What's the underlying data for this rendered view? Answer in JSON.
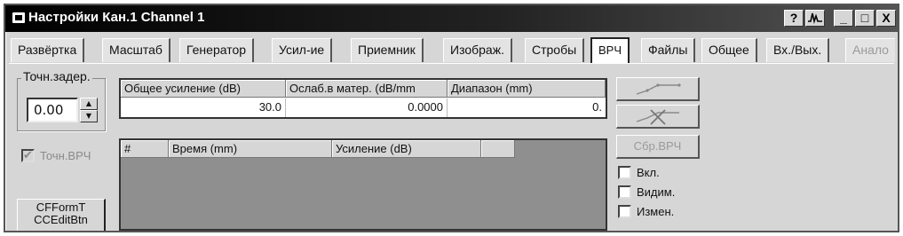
{
  "window": {
    "title": "Настройки Кан.1 Channel 1",
    "controls": [
      "?",
      "",
      "_",
      "□",
      "X"
    ]
  },
  "tabs": [
    {
      "label": "Развёртка"
    },
    {
      "label": "Масштаб"
    },
    {
      "label": "Генератор"
    },
    {
      "label": "Усил-ие"
    },
    {
      "label": "Приемник"
    },
    {
      "label": "Изображ."
    },
    {
      "label": "Стробы"
    },
    {
      "label": "ВРЧ",
      "active": true
    },
    {
      "label": "Файлы"
    },
    {
      "label": "Общее"
    },
    {
      "label": "Вх./Вых."
    },
    {
      "label": "Анало",
      "disabled": true
    }
  ],
  "delay": {
    "group_label": "Точн.задер.",
    "value": "0.00"
  },
  "tvg_checkbox": {
    "label": "Точн.ВРЧ",
    "checked": true,
    "disabled": true
  },
  "cf_button": {
    "line1": "CFFormT",
    "line2": "CCEditBtn"
  },
  "params_table": {
    "headers": [
      "Общее усиление (dB)",
      "Ослаб.в матер. (dB/mm",
      "Диапазон (mm)"
    ],
    "row": [
      "30.0",
      "0.0000",
      "0."
    ]
  },
  "points_table": {
    "headers": [
      "#",
      "Время (mm)",
      "Усиление (dB)",
      ""
    ]
  },
  "right_panel": {
    "curve_button_icon": "curve-icon",
    "clear_curve_button_icon": "curve-delete-icon",
    "reset_button_label": "Сбр.ВРЧ",
    "checkboxes": [
      {
        "label": "Вкл.",
        "checked": false
      },
      {
        "label": "Видим.",
        "checked": false
      },
      {
        "label": "Измен.",
        "checked": false
      }
    ]
  },
  "colors": {
    "title_bar": "#000000",
    "window_bg": "#d6d6d6",
    "grid_bg": "#8f8f8f"
  }
}
